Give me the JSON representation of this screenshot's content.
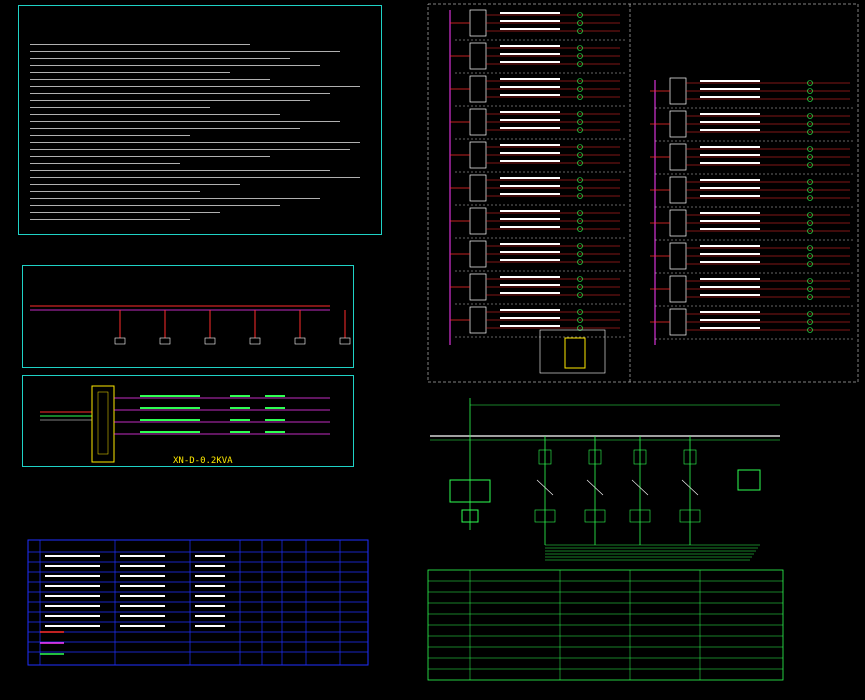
{
  "panel_notes": {
    "title": "",
    "line_count": 26
  },
  "panel_topology": {
    "title": "",
    "node_count": 6
  },
  "panel_xn": {
    "title": "XN-D-0.2KVA",
    "title_suffix": ""
  },
  "panel_table": {
    "title": ""
  },
  "drawing_bottom": {
    "caption": ""
  },
  "colors": {
    "frame": "#1fd2c6",
    "bus_red": "#ff2d2d",
    "bus_magenta": "#ff3cff",
    "wire_green": "#2eff52",
    "text_white": "#ffffff",
    "label_yellow": "#ffea00",
    "table_blue": "#1f2fff"
  }
}
